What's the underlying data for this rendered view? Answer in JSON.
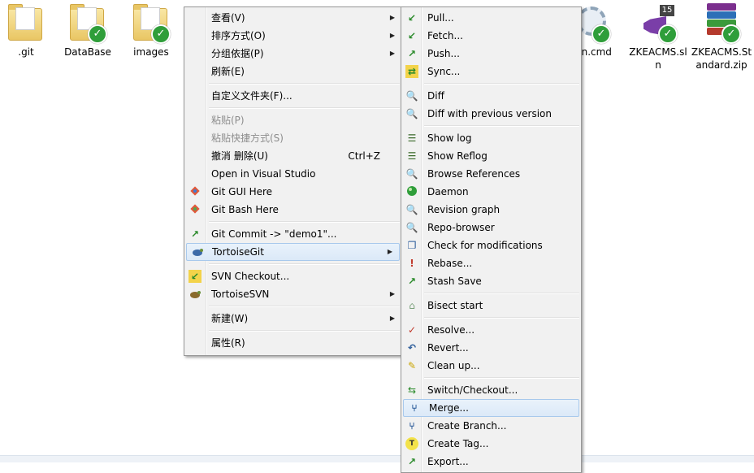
{
  "desktop": {
    "icons": [
      {
        "label": ".git"
      },
      {
        "label": "DataBase"
      },
      {
        "label": "images"
      },
      {
        "label": "run.cmd"
      },
      {
        "label": "ZKEACMS.sln",
        "badge": "15"
      },
      {
        "label": "ZKEACMS.Standard.zip"
      }
    ]
  },
  "context_menu": {
    "items": [
      {
        "label": "查看(V)",
        "submenu": true
      },
      {
        "label": "排序方式(O)",
        "submenu": true
      },
      {
        "label": "分组依据(P)",
        "submenu": true
      },
      {
        "label": "刷新(E)"
      },
      {
        "label": "自定义文件夹(F)..."
      },
      {
        "label": "粘贴(P)",
        "disabled": true
      },
      {
        "label": "粘贴快捷方式(S)",
        "disabled": true
      },
      {
        "label": "撤消 删除(U)",
        "shortcut": "Ctrl+Z"
      },
      {
        "label": "Open in Visual Studio"
      },
      {
        "label": "Git GUI Here",
        "icon": "git-gui-icon"
      },
      {
        "label": "Git Bash Here",
        "icon": "git-bash-icon"
      },
      {
        "label": "Git Commit -> \"demo1\"...",
        "icon": "git-commit-icon"
      },
      {
        "label": "TortoiseGit",
        "icon": "tortoisegit-icon",
        "submenu": true,
        "highlighted": true
      },
      {
        "label": "SVN Checkout...",
        "icon": "svn-checkout-icon"
      },
      {
        "label": "TortoiseSVN",
        "icon": "tortoisesvn-icon",
        "submenu": true
      },
      {
        "label": "新建(W)",
        "submenu": true
      },
      {
        "label": "属性(R)"
      }
    ]
  },
  "tortoisegit_submenu": {
    "items": [
      {
        "label": "Pull...",
        "icon": "pull-icon"
      },
      {
        "label": "Fetch...",
        "icon": "fetch-icon"
      },
      {
        "label": "Push...",
        "icon": "push-icon"
      },
      {
        "label": "Sync...",
        "icon": "sync-icon"
      },
      {
        "label": "Diff",
        "icon": "diff-icon"
      },
      {
        "label": "Diff with previous version",
        "icon": "diff-previous-icon"
      },
      {
        "label": "Show log",
        "icon": "show-log-icon"
      },
      {
        "label": "Show Reflog",
        "icon": "show-reflog-icon"
      },
      {
        "label": "Browse References",
        "icon": "browse-references-icon"
      },
      {
        "label": "Daemon",
        "icon": "daemon-icon"
      },
      {
        "label": "Revision graph",
        "icon": "revision-graph-icon"
      },
      {
        "label": "Repo-browser",
        "icon": "repo-browser-icon"
      },
      {
        "label": "Check for modifications",
        "icon": "check-modifications-icon"
      },
      {
        "label": "Rebase...",
        "icon": "rebase-icon"
      },
      {
        "label": "Stash Save",
        "icon": "stash-save-icon"
      },
      {
        "label": "Bisect start",
        "icon": "bisect-start-icon"
      },
      {
        "label": "Resolve...",
        "icon": "resolve-icon"
      },
      {
        "label": "Revert...",
        "icon": "revert-icon"
      },
      {
        "label": "Clean up...",
        "icon": "clean-up-icon"
      },
      {
        "label": "Switch/Checkout...",
        "icon": "switch-checkout-icon"
      },
      {
        "label": "Merge...",
        "icon": "merge-icon",
        "highlighted": true
      },
      {
        "label": "Create Branch...",
        "icon": "create-branch-icon"
      },
      {
        "label": "Create Tag...",
        "icon": "create-tag-icon"
      },
      {
        "label": "Export...",
        "icon": "export-icon"
      }
    ]
  },
  "colors": {
    "menu_bg": "#f1f1f1",
    "highlight": "#dbe9f8",
    "highlight_border": "#a8c9ec",
    "disabled_text": "#8d8d8d",
    "check_badge": "#2f9e3a"
  }
}
